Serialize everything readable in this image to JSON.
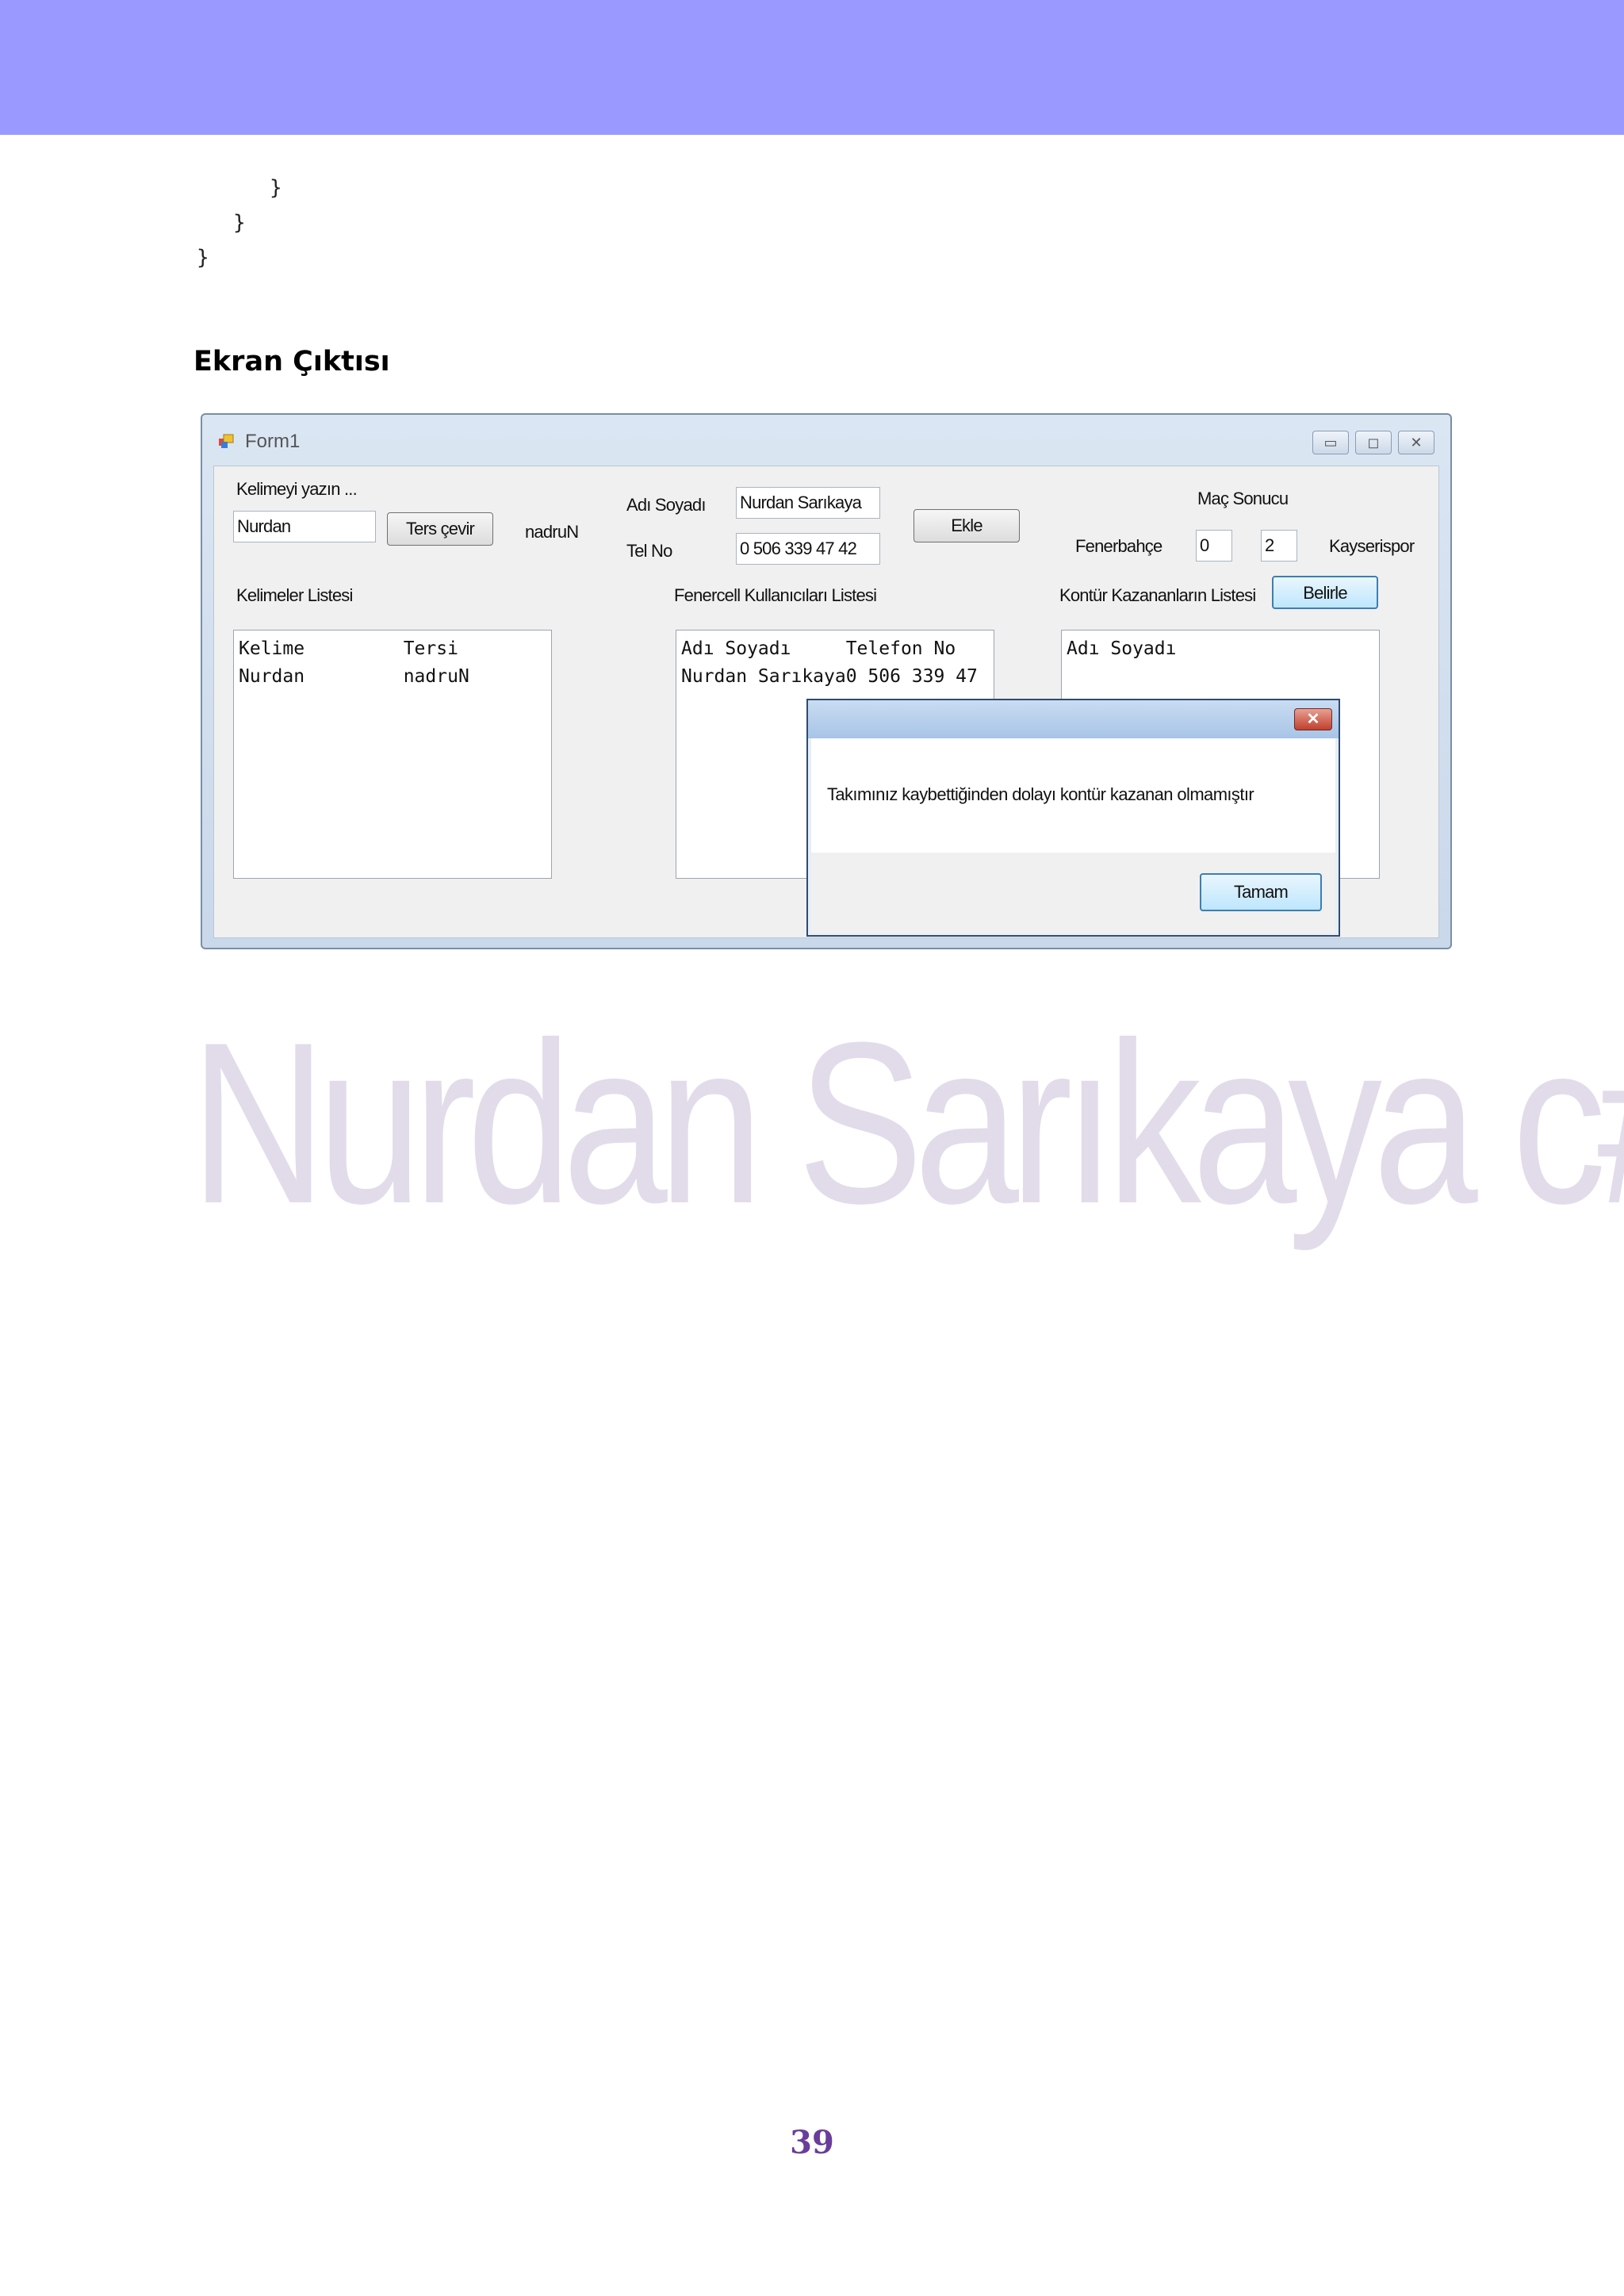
{
  "code_lines": [
    "}",
    "}",
    "}"
  ],
  "section_heading": "Ekran Çıktısı",
  "window": {
    "title": "Form1",
    "controls": {
      "minimize": "▭",
      "maximize": "◻",
      "close": "✕"
    }
  },
  "form": {
    "word_label": "Kelimeyi yazın ...",
    "word_input": "Nurdan",
    "reverse_button": "Ters çevir",
    "reverse_result": "nadruN",
    "name_label": "Adı Soyadı",
    "name_input": "Nurdan Sarıkaya",
    "phone_label": "Tel No",
    "phone_input": "0 506 339 47 42",
    "add_button": "Ekle",
    "match_label": "Maç Sonucu",
    "team1_label": "Fenerbahçe",
    "score1": "0",
    "score2": "2",
    "team2_label": "Kayserispor",
    "words_list_label": "Kelimeler Listesi",
    "users_list_label": "Fenercell Kullanıcıları Listesi",
    "winners_list_label": "Kontür Kazananların Listesi",
    "determine_button": "Belirle",
    "words_list": [
      "Kelime         Tersi",
      "Nurdan         nadruN"
    ],
    "users_list": [
      "Adı Soyadı     Telefon No",
      "Nurdan Sarıkaya0 506 339 47"
    ],
    "winners_list": [
      "Adı Soyadı"
    ]
  },
  "message_box": {
    "text": "Takımınız kaybettiğinden dolayı kontür kazanan olmamıştır",
    "ok_button": "Tamam",
    "close_icon": "✕"
  },
  "watermark": "Nurdan Sarıkaya c#",
  "page_number": "39"
}
